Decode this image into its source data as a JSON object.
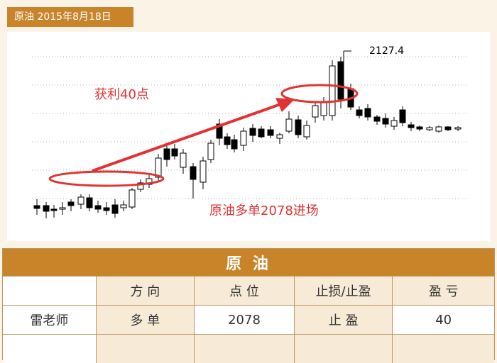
{
  "title": "原油 2015年8月18日",
  "annotations": {
    "profit_label": "获利40点",
    "entry_label": "原油多单2078进场",
    "high_label": "2127.4"
  },
  "table": {
    "title": "原 油",
    "headers": [
      "",
      "方 向",
      "点 位",
      "止损/止盈",
      "盈 亏"
    ],
    "rows": [
      [
        "雷老师",
        "多 单",
        "2078",
        "止 盈",
        "40"
      ],
      [
        "",
        "",
        "",
        "",
        ""
      ]
    ]
  },
  "colors": {
    "accent": "#c9842a",
    "annotation_red": "#e23232",
    "bull": "#ffffff",
    "bear": "#000000"
  }
}
